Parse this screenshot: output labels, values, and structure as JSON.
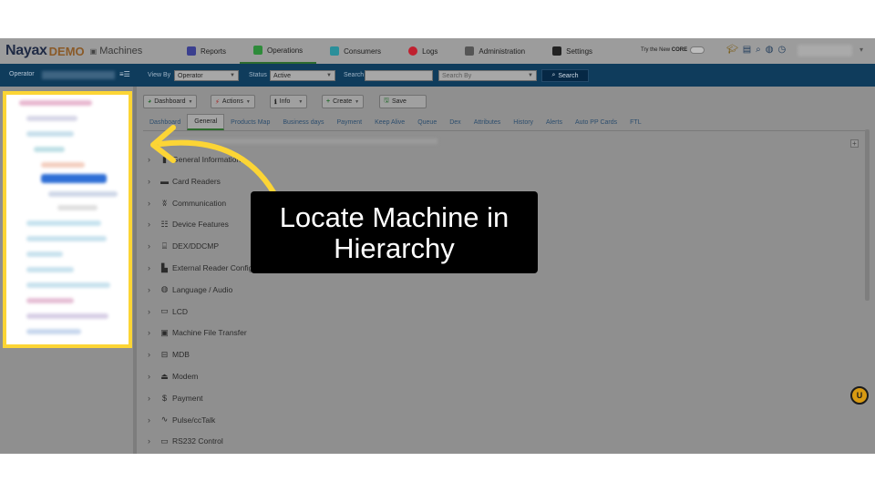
{
  "brand": {
    "logo": "Nayax",
    "demo": "DEMO",
    "section": "Machines"
  },
  "nav": {
    "tabs": [
      {
        "label": "Reports",
        "icon": "reports-icon",
        "color": "#3b3f8f"
      },
      {
        "label": "Operations",
        "icon": "operations-icon",
        "color": "#2e8b3a"
      },
      {
        "label": "Consumers",
        "icon": "consumers-icon",
        "color": "#2b8f9a"
      },
      {
        "label": "Logs",
        "icon": "logs-icon",
        "color": "#c0202f"
      },
      {
        "label": "Administration",
        "icon": "administration-icon",
        "color": "#555555"
      },
      {
        "label": "Settings",
        "icon": "settings-icon",
        "color": "#222222"
      }
    ],
    "active_tab": "Operations",
    "try_core_prefix": "Try the New",
    "try_core_brand": "CORE"
  },
  "filter": {
    "operator_label": "Operator",
    "view_by_label": "View By",
    "view_by_value": "Operator",
    "status_label": "Status",
    "status_value": "Active",
    "search_label": "Search",
    "search_value": "",
    "search_by_placeholder": "Search By",
    "search_button": "Search"
  },
  "toolbar": {
    "dashboard": "Dashboard",
    "actions": "Actions",
    "info": "Info",
    "create": "Create",
    "save": "Save"
  },
  "tabs": [
    "Dashboard",
    "General",
    "Products Map",
    "Business days",
    "Payment",
    "Keep Alive",
    "Queue",
    "Dex",
    "Attributes",
    "History",
    "Alerts",
    "Auto PP Cards",
    "FTL"
  ],
  "active_subtab": "General",
  "sections": [
    {
      "label": "General Information",
      "icon": "info-icon"
    },
    {
      "label": "Card Readers",
      "icon": "card-reader-icon"
    },
    {
      "label": "Communication",
      "icon": "antenna-icon"
    },
    {
      "label": "Device Features",
      "icon": "features-icon"
    },
    {
      "label": "DEX/DDCMP",
      "icon": "dex-icon"
    },
    {
      "label": "External Reader Configuration",
      "icon": "external-reader-icon"
    },
    {
      "label": "Language / Audio",
      "icon": "globe-icon"
    },
    {
      "label": "LCD",
      "icon": "lcd-icon"
    },
    {
      "label": "Machine File Transfer",
      "icon": "file-transfer-icon"
    },
    {
      "label": "MDB",
      "icon": "mdb-icon"
    },
    {
      "label": "Modem",
      "icon": "modem-icon"
    },
    {
      "label": "Payment",
      "icon": "dollar-icon"
    },
    {
      "label": "Pulse/ccTalk",
      "icon": "pulse-icon"
    },
    {
      "label": "RS232 Control",
      "icon": "rs232-icon"
    }
  ],
  "callout": {
    "line1": "Locate Machine in",
    "line2": "Hierarchy"
  },
  "colors": {
    "highlight": "#fcd535",
    "filterbar": "#0f3c5c",
    "callout_bg": "#000000"
  }
}
